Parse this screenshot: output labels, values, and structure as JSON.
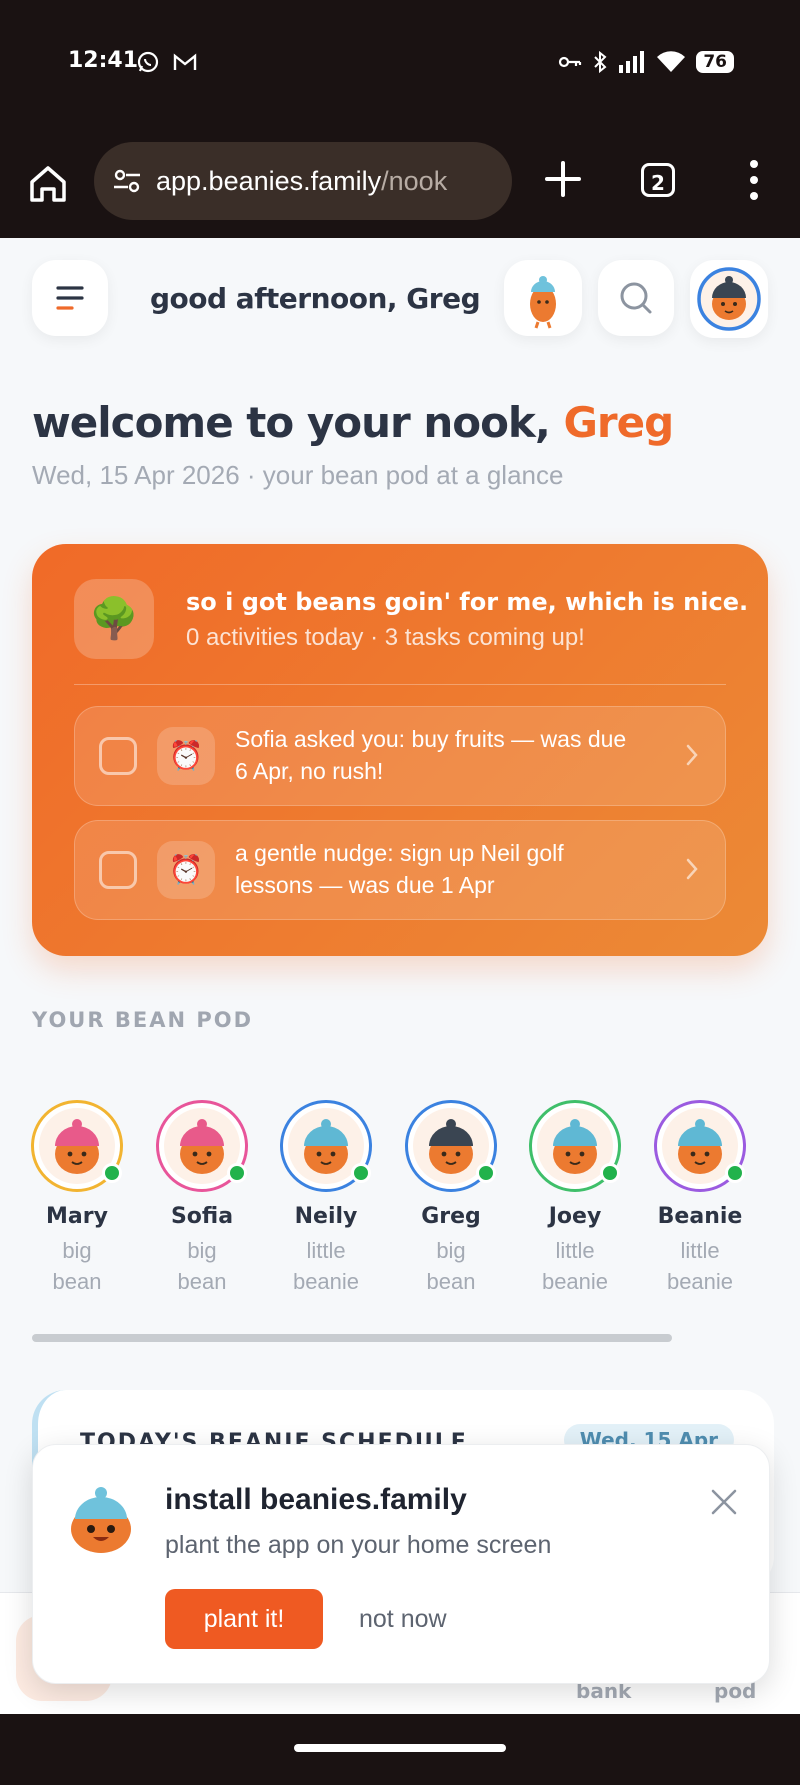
{
  "status_bar": {
    "time": "12:41",
    "battery": "76",
    "icons": [
      "whatsapp-icon",
      "gmail-icon",
      "key-icon",
      "bluetooth-icon",
      "signal-icon",
      "wifi-icon"
    ]
  },
  "browser": {
    "url_domain": "app.beanies.family",
    "url_path": "/nook",
    "tab_count": "2"
  },
  "header": {
    "greeting": "good afternoon, Greg"
  },
  "welcome": {
    "prefix": "welcome to your nook,",
    "name": "Greg",
    "subtitle": "Wed, 15 Apr 2026 · your bean pod at a glance"
  },
  "summary_card": {
    "title": "so i got beans goin' for me, which is nice.",
    "subtitle": "0 activities today · 3 tasks coming up!",
    "tasks": [
      {
        "text": "Sofia asked you: buy fruits — was due 6 Apr, no rush!",
        "checked": false
      },
      {
        "text": "a gentle nudge: sign up Neil golf lessons — was due 1 Apr",
        "checked": false
      }
    ]
  },
  "bean_pod": {
    "label": "YOUR BEAN POD",
    "members": [
      {
        "name": "Mary",
        "role_line1": "big",
        "role_line2": "bean",
        "ring": "#f2b431",
        "hat": "#e85a8a",
        "online": true
      },
      {
        "name": "Sofia",
        "role_line1": "big",
        "role_line2": "bean",
        "ring": "#e8559a",
        "hat": "#e85a8a",
        "online": true
      },
      {
        "name": "Neily",
        "role_line1": "little",
        "role_line2": "beanie",
        "ring": "#3b82e0",
        "hat": "#5fb8d4",
        "online": true
      },
      {
        "name": "Greg",
        "role_line1": "big",
        "role_line2": "bean",
        "ring": "#3b82e0",
        "hat": "#3a4552",
        "online": true
      },
      {
        "name": "Joey",
        "role_line1": "little",
        "role_line2": "beanie",
        "ring": "#3fbf6a",
        "hat": "#5fb8d4",
        "online": true
      },
      {
        "name": "Beanie",
        "role_line1": "little",
        "role_line2": "beanie",
        "ring": "#9b5be0",
        "hat": "#5fb8d4",
        "online": true
      }
    ]
  },
  "schedule": {
    "title": "TODAY'S BEANIE SCHEDULE",
    "date": "Wed, 15 Apr"
  },
  "bottom_nav": {
    "items": [
      "bank",
      "pod"
    ]
  },
  "install_prompt": {
    "title": "install beanies.family",
    "subtitle": "plant the app on your home screen",
    "primary_label": "plant it!",
    "secondary_label": "not now"
  },
  "colors": {
    "accent": "#ef6a2a",
    "online": "#22b24c",
    "text": "#2c3444",
    "muted": "#a4aab4"
  }
}
